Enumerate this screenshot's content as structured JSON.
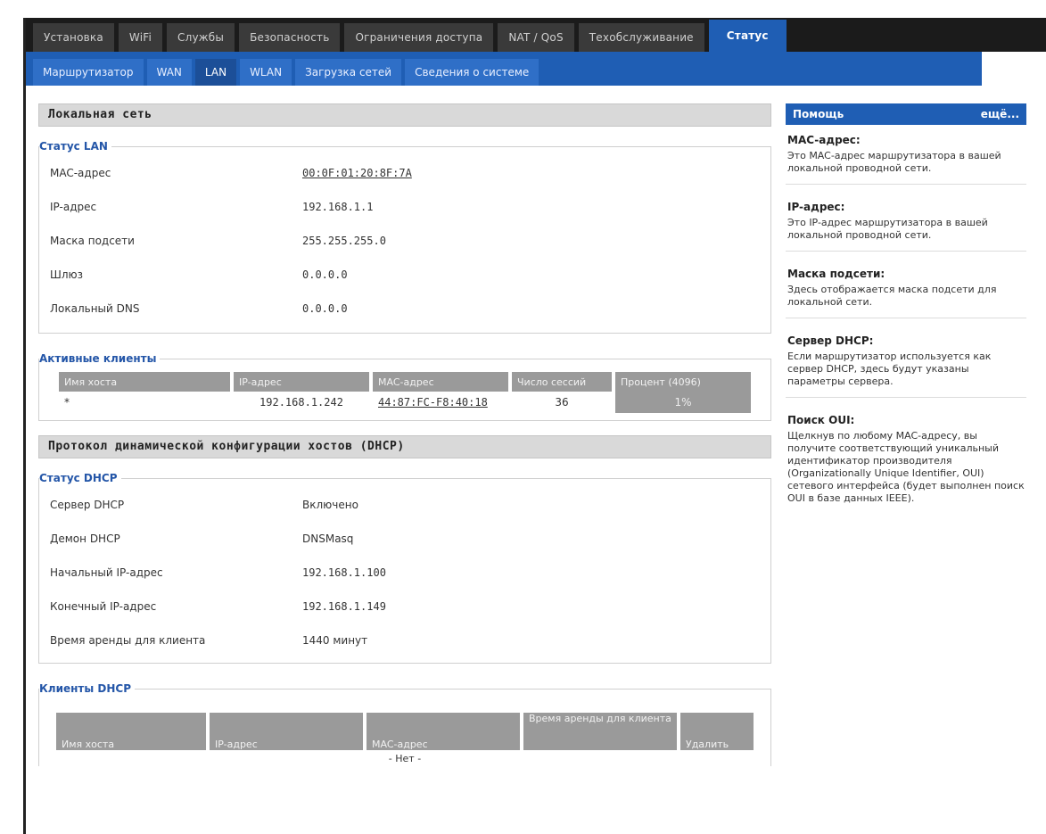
{
  "nav": {
    "tabs": [
      "Установка",
      "WiFi",
      "Службы",
      "Безопасность",
      "Ограничения доступа",
      "NAT / QoS",
      "Техобслуживание",
      "Статус"
    ],
    "active_tab": "Статус",
    "subtabs": [
      "Маршрутизатор",
      "WAN",
      "LAN",
      "WLAN",
      "Загрузка сетей",
      "Сведения о системе"
    ],
    "active_subtab": "LAN"
  },
  "lan": {
    "section_title": "Локальная сеть",
    "status_legend": "Статус LAN",
    "rows": [
      {
        "label": "MAC-адрес",
        "value": "00:0F:01:20:8F:7A"
      },
      {
        "label": "IP-адрес",
        "value": "192.168.1.1"
      },
      {
        "label": "Маска подсети",
        "value": "255.255.255.0"
      },
      {
        "label": "Шлюз",
        "value": "0.0.0.0"
      },
      {
        "label": "Локальный DNS",
        "value": "0.0.0.0"
      }
    ]
  },
  "clients": {
    "legend": "Активные клиенты",
    "headers": [
      "Имя хоста",
      "IP-адрес",
      "MAC-адрес",
      "Число сессий",
      "Процент (4096)"
    ],
    "rows": [
      {
        "host": "*",
        "ip": "192.168.1.242",
        "mac": "44:87:FC-F8:40:18",
        "sessions": "36",
        "percent": "1%"
      }
    ]
  },
  "dhcp": {
    "section_title": "Протокол динамической конфигурации хостов (DHCP)",
    "status_legend": "Статус DHCP",
    "rows": [
      {
        "label": "Сервер DHCP",
        "value": "Включено"
      },
      {
        "label": "Демон DHCP",
        "value": "DNSMasq"
      },
      {
        "label": "Начальный IP-адрес",
        "value": "192.168.1.100"
      },
      {
        "label": "Конечный IP-адрес",
        "value": "192.168.1.149"
      },
      {
        "label": "Время аренды для клиента",
        "value": "1440 минут"
      }
    ],
    "clients_legend": "Клиенты DHCP",
    "clients_headers": [
      "Имя хоста",
      "IP-адрес",
      "MAC-адрес",
      "Время аренды для клиента",
      "Удалить"
    ],
    "clients_empty": "- Нет -"
  },
  "help": {
    "title": "Помощь",
    "more": "ещё...",
    "items": [
      {
        "title": "MAC-адрес:",
        "text": "Это MAC-адрес маршрутизатора в вашей локальной проводной сети."
      },
      {
        "title": "IP-адрес:",
        "text": "Это IP-адрес маршрутизатора в вашей локальной проводной сети."
      },
      {
        "title": "Маска подсети:",
        "text": "Здесь отображается маска подсети для локальной сети."
      },
      {
        "title": "Сервер DHCP:",
        "text": "Если маршрутизатор используется как сервер DHCP, здесь будут указаны параметры сервера."
      },
      {
        "title": "Поиск OUI:",
        "text": "Щелкнув по любому MAC-адресу, вы получите соответствующий уникальный идентификатор производителя (Organizationally Unique Identifier, OUI) сетевого интерфейса (будет выполнен поиск OUI в базе данных IEEE)."
      }
    ]
  }
}
